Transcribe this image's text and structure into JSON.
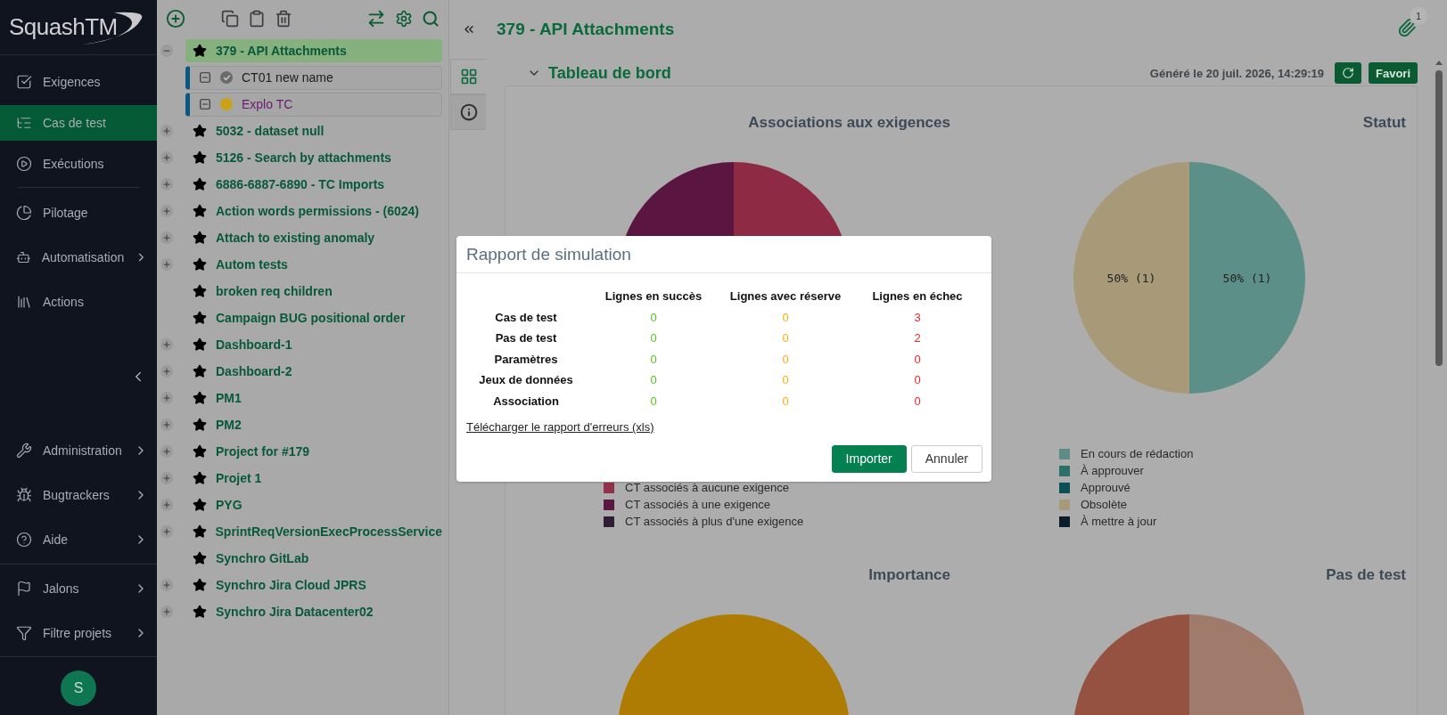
{
  "sidebar": {
    "logo": "SquashTM",
    "groups": [
      {
        "items": [
          {
            "label": "Exigences",
            "selected": false,
            "submenu": false
          },
          {
            "label": "Cas de test",
            "selected": true,
            "submenu": false
          },
          {
            "label": "Exécutions",
            "selected": false,
            "submenu": false
          }
        ]
      },
      {
        "items": [
          {
            "label": "Pilotage",
            "selected": false,
            "submenu": false
          },
          {
            "label": "Automatisation",
            "selected": false,
            "submenu": true
          },
          {
            "label": "Actions",
            "selected": false,
            "submenu": false
          }
        ]
      },
      {
        "items": [
          {
            "label": "Administration",
            "selected": false,
            "submenu": true
          },
          {
            "label": "Bugtrackers",
            "selected": false,
            "submenu": true
          },
          {
            "label": "Aide",
            "selected": false,
            "submenu": true
          }
        ]
      },
      {
        "items": [
          {
            "label": "Jalons",
            "selected": false,
            "submenu": true
          },
          {
            "label": "Filtre projets",
            "selected": false,
            "submenu": true
          }
        ]
      }
    ],
    "avatar": "S"
  },
  "tree": {
    "nodes": [
      {
        "label": "379 - API Attachments",
        "selected": true,
        "expandable": true,
        "expanded": true,
        "children": [
          {
            "label": "CT01 new name",
            "kind": "standard",
            "color": "#6b6b6b"
          },
          {
            "label": "Explo TC",
            "kind": "exploratory",
            "color": "#c9a21a"
          }
        ]
      },
      {
        "label": "5032 - dataset null",
        "selected": false,
        "expandable": true,
        "expanded": false
      },
      {
        "label": "5126 - Search by attachments",
        "selected": false,
        "expandable": true,
        "expanded": false
      },
      {
        "label": "6886-6887-6890 - TC Imports",
        "selected": false,
        "expandable": true,
        "expanded": false
      },
      {
        "label": "Action words permissions - (6024)",
        "selected": false,
        "expandable": true,
        "expanded": false
      },
      {
        "label": "Attach to existing anomaly",
        "selected": false,
        "expandable": true,
        "expanded": false
      },
      {
        "label": "Autom tests",
        "selected": false,
        "expandable": true,
        "expanded": false
      },
      {
        "label": "broken req children",
        "selected": false,
        "expandable": false
      },
      {
        "label": "Campaign BUG positional order",
        "selected": false,
        "expandable": false
      },
      {
        "label": "Dashboard-1",
        "selected": false,
        "expandable": true,
        "expanded": false
      },
      {
        "label": "Dashboard-2",
        "selected": false,
        "expandable": true,
        "expanded": false
      },
      {
        "label": "PM1",
        "selected": false,
        "expandable": true,
        "expanded": false
      },
      {
        "label": "PM2",
        "selected": false,
        "expandable": true,
        "expanded": false
      },
      {
        "label": "Project for #179",
        "selected": false,
        "expandable": true,
        "expanded": false
      },
      {
        "label": "Projet 1",
        "selected": false,
        "expandable": true,
        "expanded": false
      },
      {
        "label": "PYG",
        "selected": false,
        "expandable": true,
        "expanded": false
      },
      {
        "label": "SprintReqVersionExecProcessService",
        "selected": false,
        "expandable": true,
        "expanded": false
      },
      {
        "label": "Synchro GitLab",
        "selected": false,
        "expandable": false
      },
      {
        "label": "Synchro Jira Cloud JPRS",
        "selected": false,
        "expandable": true,
        "expanded": false
      },
      {
        "label": "Synchro Jira Datacenter02",
        "selected": false,
        "expandable": true,
        "expanded": false
      }
    ]
  },
  "content": {
    "title": "379 - API Attachments",
    "attachments_badge": "1",
    "side_tabs": [
      {
        "selected": true
      },
      {
        "selected": false
      }
    ],
    "dashboard": {
      "title": "Tableau de bord",
      "generated": "Généré le 20 juil. 2026, 14:29:19",
      "favorite_button": "Favori",
      "charts": [
        {
          "title": "Associations aux exigences",
          "legend": [
            {
              "label": "CT associés à aucune exigence",
              "color": "#93304a"
            },
            {
              "label": "CT associés à une exigence",
              "color": "#5a1640"
            },
            {
              "label": "CT associés à plus d'une exigence",
              "color": "#2d1e35"
            }
          ]
        },
        {
          "title": "Statut",
          "chart_data": {
            "type": "pie",
            "values": [
              1,
              1
            ],
            "value_labels": [
              "50% (1)",
              "50% (1)"
            ],
            "colors": [
              "#5b8f88",
              "#a89a78"
            ]
          },
          "legend": [
            {
              "label": "En cours de rédaction",
              "color": "#5b8c86"
            },
            {
              "label": "À approuver",
              "color": "#2f6f6a"
            },
            {
              "label": "Approuvé",
              "color": "#0b5055"
            },
            {
              "label": "Obsolète",
              "color": "#a89a78"
            },
            {
              "label": "À mettre à jour",
              "color": "#0b1c2a"
            }
          ]
        },
        {
          "title": "Importance"
        },
        {
          "title": "Pas de test"
        }
      ]
    }
  },
  "modal": {
    "title": "Rapport de simulation",
    "columns": [
      "Lignes en succès",
      "Lignes avec réserve",
      "Lignes en échec"
    ],
    "rows": [
      {
        "label": "Cas de test",
        "values": [
          "0",
          "0",
          "3"
        ]
      },
      {
        "label": "Pas de test",
        "values": [
          "0",
          "0",
          "2"
        ]
      },
      {
        "label": "Paramètres",
        "values": [
          "0",
          "0",
          "0"
        ]
      },
      {
        "label": "Jeux de données",
        "values": [
          "0",
          "0",
          "0"
        ]
      },
      {
        "label": "Association",
        "values": [
          "0",
          "0",
          "0"
        ]
      }
    ],
    "link": "Télécharger le rapport d'erreurs (xls)",
    "buttons": [
      {
        "label": "Importer",
        "kind": "primary"
      },
      {
        "label": "Annuler",
        "kind": "secondary"
      }
    ]
  }
}
